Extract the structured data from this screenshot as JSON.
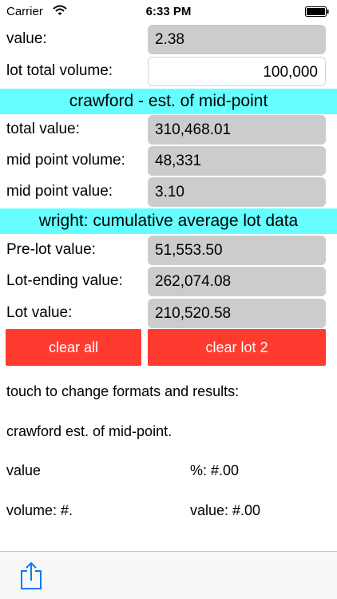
{
  "status": {
    "carrier": "Carrier",
    "time": "6:33 PM"
  },
  "inputs": {
    "value_label": "value:",
    "value": "2.38",
    "lot_total_volume_label": "lot total volume:",
    "lot_total_volume": "100,000"
  },
  "crawford": {
    "header": "crawford - est. of mid-point",
    "total_value_label": "total value:",
    "total_value": "310,468.01",
    "mid_point_volume_label": "mid point volume:",
    "mid_point_volume": "48,331",
    "mid_point_value_label": "mid point value:",
    "mid_point_value": "3.10"
  },
  "wright": {
    "header": "wright: cumulative average lot data",
    "pre_lot_value_label": "Pre-lot value:",
    "pre_lot_value": "51,553.50",
    "lot_ending_value_label": "Lot-ending value:",
    "lot_ending_value": "262,074.08",
    "lot_value_label": "Lot value:",
    "lot_value": "210,520.58"
  },
  "buttons": {
    "clear_all": "clear all",
    "clear_lot": "clear lot 2"
  },
  "formats": {
    "instruction": "touch to change formats and results:",
    "mode": "crawford est. of mid-point.",
    "value": "value",
    "percent": "%: #.00",
    "volume": "volume: #.",
    "value_format": "value: #.00"
  },
  "colors": {
    "section_header": "#66ffff",
    "button": "#ff3b30",
    "value_box": "#cccccc",
    "accent": "#007aff"
  },
  "icons": {
    "status": [
      "wifi-icon",
      "battery-icon"
    ],
    "toolbar": [
      "share-icon"
    ]
  }
}
